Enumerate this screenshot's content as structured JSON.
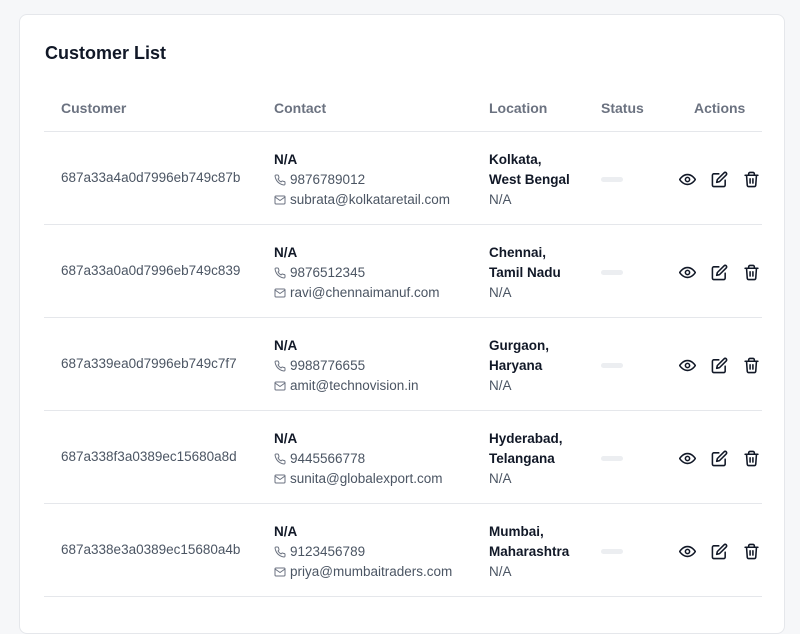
{
  "page": {
    "title": "Customer List"
  },
  "table": {
    "headers": {
      "customer": "Customer",
      "contact": "Contact",
      "location": "Location",
      "status": "Status",
      "actions": "Actions"
    },
    "rows": [
      {
        "id": "687a33a4a0d7996eb749c87b",
        "name": "N/A",
        "phone": "9876789012",
        "email": "subrata@kolkataretail.com",
        "city": "Kolkata,",
        "state": "West Bengal",
        "location_extra": "N/A"
      },
      {
        "id": "687a33a0a0d7996eb749c839",
        "name": "N/A",
        "phone": "9876512345",
        "email": "ravi@chennaimanuf.com",
        "city": "Chennai,",
        "state": "Tamil Nadu",
        "location_extra": "N/A"
      },
      {
        "id": "687a339ea0d7996eb749c7f7",
        "name": "N/A",
        "phone": "9988776655",
        "email": "amit@technovision.in",
        "city": "Gurgaon,",
        "state": "Haryana",
        "location_extra": "N/A"
      },
      {
        "id": "687a338f3a0389ec15680a8d",
        "name": "N/A",
        "phone": "9445566778",
        "email": "sunita@globalexport.com",
        "city": "Hyderabad,",
        "state": "Telangana",
        "location_extra": "N/A"
      },
      {
        "id": "687a338e3a0389ec15680a4b",
        "name": "N/A",
        "phone": "9123456789",
        "email": "priya@mumbaitraders.com",
        "city": "Mumbai,",
        "state": "Maharashtra",
        "location_extra": "N/A"
      }
    ]
  },
  "icons": {
    "phone": "phone-icon",
    "email": "mail-icon",
    "view": "eye-icon",
    "edit": "edit-icon",
    "delete": "trash-icon"
  }
}
